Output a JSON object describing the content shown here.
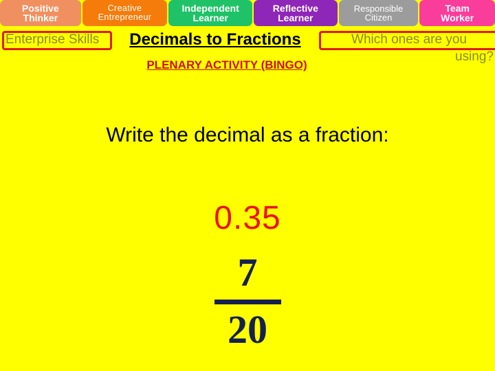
{
  "colors": {
    "background": "#FFFF00",
    "title": "#000000",
    "subtitle_red": "#CC1100",
    "olive": "#8A8A1F",
    "box_border": "#E01B00",
    "decimal_red": "#EE1100",
    "fraction_navy": "#152050"
  },
  "tabs": [
    {
      "line1": "Positive",
      "line2": "Thinker",
      "color": "#F09060"
    },
    {
      "line1": "Creative",
      "line2": "Entrepreneur",
      "color": "#F57C0A"
    },
    {
      "line1": "Independent",
      "line2": "Learner",
      "color": "#20C268"
    },
    {
      "line1": "Reflective",
      "line2": "Learner",
      "color": "#8E26B8"
    },
    {
      "line1": "Responsible",
      "line2": "Citizen",
      "color": "#9C9C9C"
    },
    {
      "line1": "Team",
      "line2": "Worker",
      "color": "#FA3C9B"
    }
  ],
  "header": {
    "enterprise_label": "Enterprise Skills",
    "title": "Decimals to Fractions",
    "subtitle": "PLENARY ACTIVITY (BINGO)",
    "question_line1": "Which ones are you",
    "question_line2": "using?"
  },
  "main": {
    "prompt": "Write the decimal as a fraction:",
    "decimal": "0.35",
    "fraction": {
      "numerator": "7",
      "denominator": "20"
    }
  }
}
